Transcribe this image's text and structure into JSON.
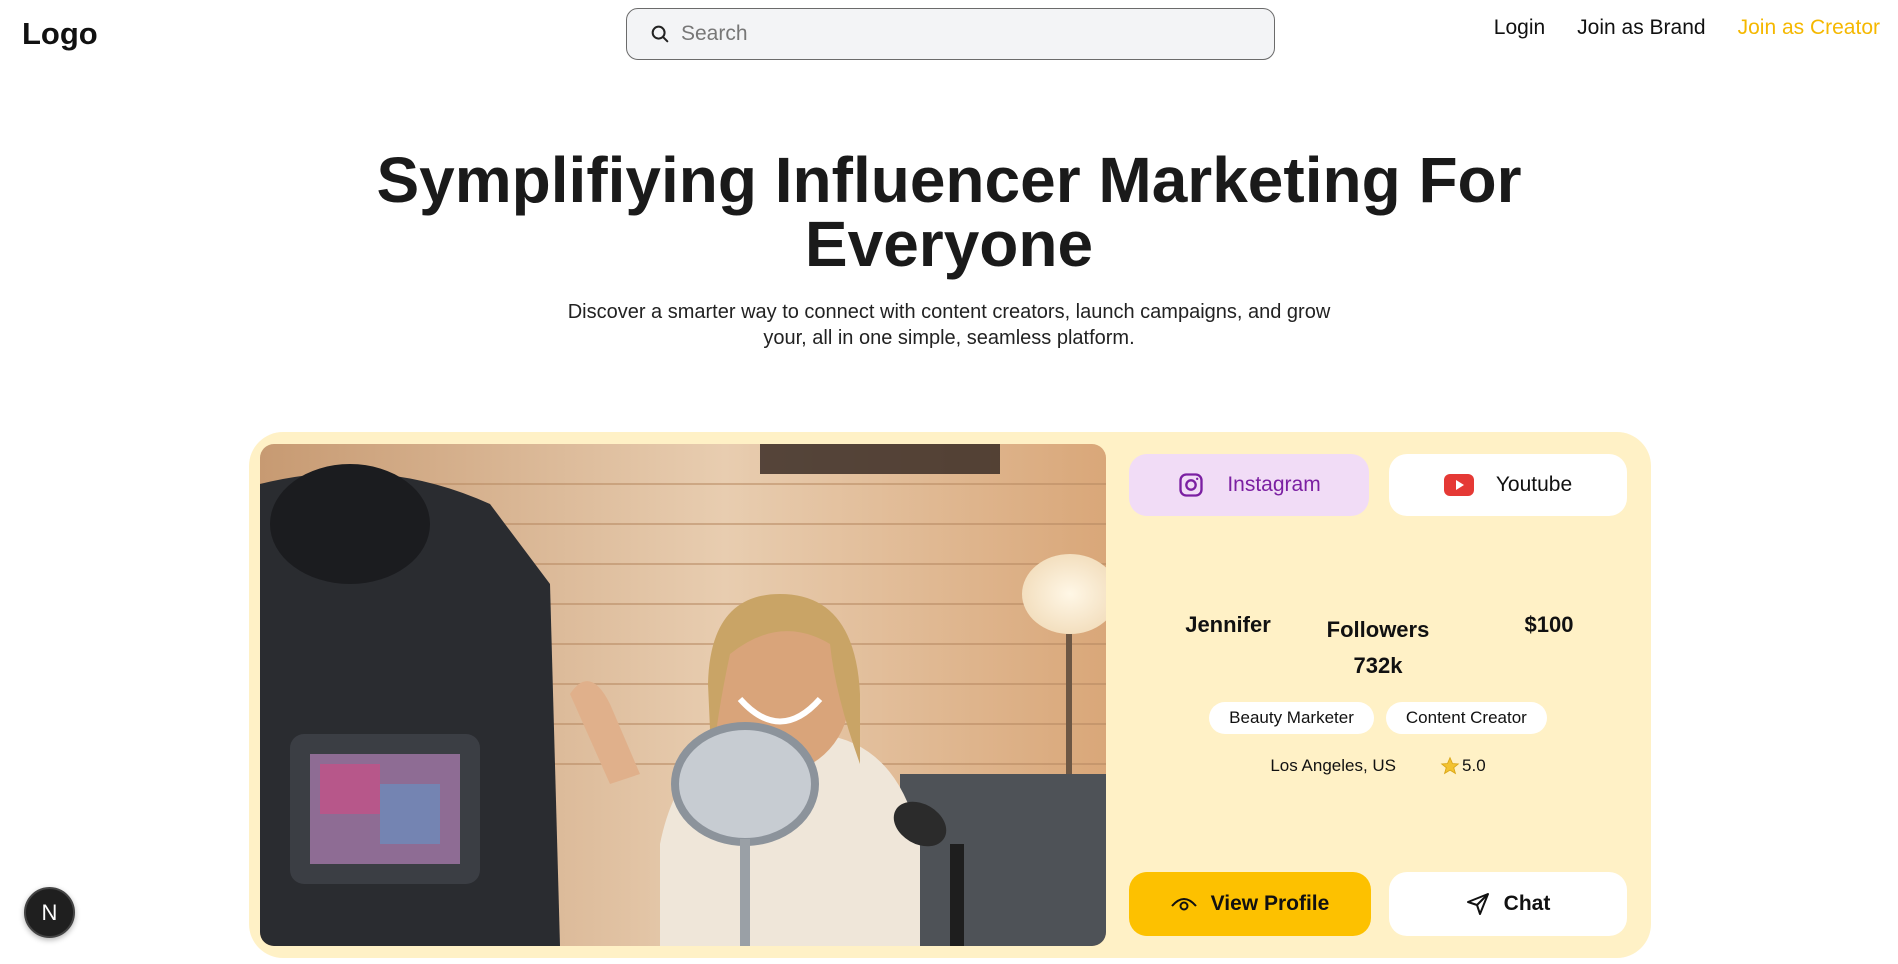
{
  "header": {
    "logo": "Logo",
    "search_placeholder": "Search",
    "nav": {
      "login": "Login",
      "join_brand": "Join as Brand",
      "join_creator": "Join as Creator"
    }
  },
  "hero": {
    "title_line1": "Symplifiying Influencer Marketing For",
    "title_line2": "Everyone",
    "subtitle": "Discover a smarter way to connect with content creators, launch campaigns, and grow your, all in one simple, seamless platform."
  },
  "creator_card": {
    "platforms": {
      "instagram": "Instagram",
      "youtube": "Youtube"
    },
    "name": "Jennifer",
    "followers_label": "Followers",
    "followers_value": "732k",
    "price": "$100",
    "tags": [
      "Beauty Marketer",
      "Content Creator"
    ],
    "location": "Los Angeles, US",
    "rating": "5.0",
    "view_profile_label": "View Profile",
    "chat_label": "Chat"
  },
  "dev_badge": "N",
  "colors": {
    "accent_yellow": "#fdc100",
    "creator_link": "#f5b800",
    "card_bg": "#fff1c6",
    "instagram_pill": "#f1dcf6",
    "instagram_text": "#7b1fa2",
    "youtube_red": "#e53935"
  },
  "icons": [
    "search-icon",
    "instagram-icon",
    "youtube-icon",
    "eye-icon",
    "send-icon",
    "star-icon"
  ]
}
